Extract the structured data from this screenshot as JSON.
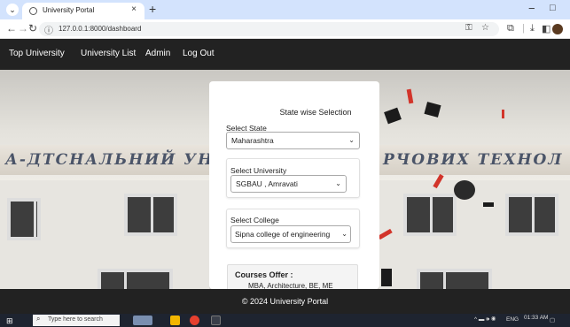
{
  "browser": {
    "tab_title": "University Portal",
    "tab_close": "×",
    "new_tab": "+",
    "url": "127.0.0.1:8000/dashboard",
    "window_min": "−",
    "window_max": "□"
  },
  "icons": {
    "tab_menu": "chevron-down-icon",
    "back": "back-arrow-icon",
    "forward": "forward-arrow-icon",
    "reload": "reload-icon",
    "site_info": "site-info-icon",
    "password": "key-icon",
    "bookmark": "star-icon",
    "extensions": "puzzle-icon",
    "download": "download-icon",
    "sidebar": "sidebar-icon",
    "profile": "avatar-icon"
  },
  "nav": {
    "items": [
      "Top University",
      "University List",
      "Admin",
      "Log Out"
    ]
  },
  "hero": {
    "sign_left": "А-ДТСНАЛЬНИЙ УН",
    "sign_right": "РЧОВИХ ТЕХНОЛ"
  },
  "form": {
    "title": "State wise Selection",
    "state_label": "Select State",
    "state_value": "Maharashtra",
    "university_label": "Select University",
    "university_value": "SGBAU , Amravati",
    "college_label": "Select College",
    "college_value": "Sipna college of engineering",
    "courses_title": "Courses Offer :",
    "courses_value": "MBA, Architecture, BE, ME"
  },
  "footer": {
    "text": "© 2024 University Portal"
  },
  "taskbar": {
    "search_placeholder": "Type here to search",
    "lang": "ENG",
    "time": "01:33 AM"
  },
  "colors": {
    "tabstrip": "#d3e3fd",
    "navbar": "#222222",
    "footer": "#222222",
    "taskbar": "#1e2430"
  }
}
